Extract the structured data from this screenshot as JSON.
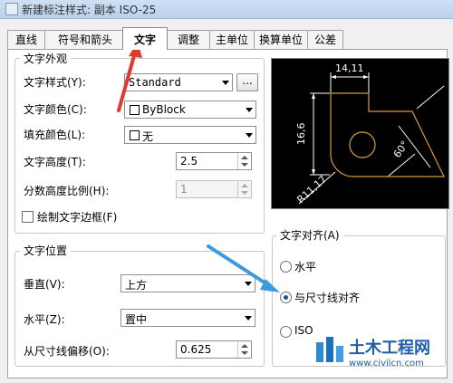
{
  "window": {
    "title": "新建标注样式: 副本 ISO-25"
  },
  "tabs": [
    {
      "label": "直线"
    },
    {
      "label": "符号和箭头"
    },
    {
      "label": "文字"
    },
    {
      "label": "调整"
    },
    {
      "label": "主单位"
    },
    {
      "label": "换算单位"
    },
    {
      "label": "公差"
    }
  ],
  "text_appearance": {
    "group_label": "文字外观",
    "text_style_label": "文字样式(Y):",
    "text_style_value": "Standard",
    "browse_button": "...",
    "text_color_label": "文字颜色(C):",
    "text_color_value": "ByBlock",
    "fill_color_label": "填充颜色(L):",
    "fill_color_value": "无",
    "text_height_label": "文字高度(T):",
    "text_height_value": "2.5",
    "fraction_scale_label": "分数高度比例(H):",
    "fraction_scale_value": "1",
    "draw_frame_label": "绘制文字边框(F)"
  },
  "text_placement": {
    "group_label": "文字位置",
    "vertical_label": "垂直(V):",
    "vertical_value": "上方",
    "horizontal_label": "水平(Z):",
    "horizontal_value": "置中",
    "offset_label": "从尺寸线偏移(O):",
    "offset_value": "0.625"
  },
  "text_alignment": {
    "group_label": "文字对齐(A)",
    "options": [
      {
        "label": "水平"
      },
      {
        "label": "与尺寸线对齐"
      },
      {
        "label": "ISO"
      }
    ],
    "selected_index": 1
  },
  "preview": {
    "dim_top": "14,11",
    "dim_left": "16,6",
    "dim_angle": "60°",
    "dim_radius": "R11,17"
  },
  "watermark": {
    "site_name": "土木工程网",
    "url": "www.civilcn.com"
  },
  "colors": {
    "arrow_red": "#e23a2a",
    "arrow_blue": "#3c9be0",
    "preview_bg": "#000000",
    "preview_lines": "#ffffff",
    "preview_shape": "#d89a3a",
    "radio_fill": "#1d4e9e"
  }
}
